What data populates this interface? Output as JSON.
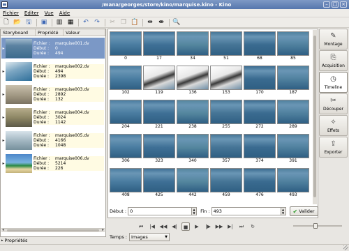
{
  "window": {
    "title": "/mana/georges/store/kino/marquise.kino - Kino",
    "app_icon": "film-icon",
    "controls": [
      "minimize",
      "maximize",
      "close"
    ]
  },
  "menu": [
    "Fichier",
    "Editer",
    "Vue",
    "Aide"
  ],
  "toolbar": {
    "icons": [
      "new-icon",
      "open-icon",
      "save-icon",
      "export-icon",
      "cut-scene-icon",
      "split-scene-icon",
      "undo-icon",
      "redo-icon",
      "cut-icon",
      "copy-icon",
      "paste-icon",
      "trim-start-icon",
      "trim-end-icon",
      "zoom-icon"
    ]
  },
  "storyboard": {
    "headers": [
      "Storyboard",
      "Propriété",
      "Valeur"
    ],
    "field_labels": [
      "Fichier :",
      "Début :",
      "Durée :"
    ],
    "clips": [
      {
        "file": "marquise001.dv",
        "start": "0",
        "duration": "494",
        "selected": true,
        "palette": "sea"
      },
      {
        "file": "marquise002.dv",
        "start": "494",
        "duration": "2398",
        "selected": false,
        "palette": "pool"
      },
      {
        "file": "marquise003.dv",
        "start": "2892",
        "duration": "132",
        "selected": false,
        "palette": "sand"
      },
      {
        "file": "marquise004.dv",
        "start": "3024",
        "duration": "1142",
        "selected": false,
        "palette": "rock"
      },
      {
        "file": "marquise005.dv",
        "start": "4166",
        "duration": "1048",
        "selected": false,
        "palette": "boat"
      },
      {
        "file": "marquise006.dv",
        "start": "5214",
        "duration": "226",
        "selected": false,
        "palette": "beach"
      }
    ],
    "properties_label": "Propriétés"
  },
  "frames": [
    {
      "label": "0",
      "kind": "sea"
    },
    {
      "label": "17",
      "kind": "sea"
    },
    {
      "label": "34",
      "kind": "sea"
    },
    {
      "label": "51",
      "kind": "sea"
    },
    {
      "label": "68",
      "kind": "sea"
    },
    {
      "label": "85",
      "kind": "sea"
    },
    {
      "label": "102",
      "kind": "sea"
    },
    {
      "label": "119",
      "kind": "deck"
    },
    {
      "label": "136",
      "kind": "deck"
    },
    {
      "label": "153",
      "kind": "deck"
    },
    {
      "label": "170",
      "kind": "sea"
    },
    {
      "label": "187",
      "kind": "sea"
    },
    {
      "label": "204",
      "kind": "sea"
    },
    {
      "label": "221",
      "kind": "sea"
    },
    {
      "label": "238",
      "kind": "sea"
    },
    {
      "label": "255",
      "kind": "sea"
    },
    {
      "label": "272",
      "kind": "sea"
    },
    {
      "label": "289",
      "kind": "sea"
    },
    {
      "label": "306",
      "kind": "sea"
    },
    {
      "label": "323",
      "kind": "sea"
    },
    {
      "label": "340",
      "kind": "sea"
    },
    {
      "label": "357",
      "kind": "sea"
    },
    {
      "label": "374",
      "kind": "sea"
    },
    {
      "label": "391",
      "kind": "sea"
    },
    {
      "label": "408",
      "kind": "sea"
    },
    {
      "label": "425",
      "kind": "sea"
    },
    {
      "label": "442",
      "kind": "sea"
    },
    {
      "label": "459",
      "kind": "sea"
    },
    {
      "label": "476",
      "kind": "sea"
    },
    {
      "label": "493",
      "kind": "sea"
    }
  ],
  "range": {
    "start_label": "Début :",
    "start_value": "0",
    "end_label": "Fin :",
    "end_value": "493",
    "validate_label": "Valider"
  },
  "modes": [
    {
      "label": "Montage",
      "icon": "edit-icon",
      "active": false
    },
    {
      "label": "Acquisition",
      "icon": "capture-icon",
      "active": false
    },
    {
      "label": "Timeline",
      "icon": "clock-icon",
      "active": true
    },
    {
      "label": "Découper",
      "icon": "trim-icon",
      "active": false
    },
    {
      "label": "Effets",
      "icon": "effects-icon",
      "active": false
    },
    {
      "label": "Exporter",
      "icon": "export-icon",
      "active": false
    }
  ],
  "transport": [
    "first-scene-icon",
    "previous-scene-icon",
    "rewind-icon",
    "step-back-icon",
    "stop-icon",
    "play-icon",
    "step-forward-icon",
    "fast-forward-icon",
    "next-scene-icon",
    "last-scene-icon",
    "loop-icon"
  ],
  "volume_level": 0.45,
  "time": {
    "label": "Temps :",
    "unit_value": "Images"
  },
  "colors": {
    "selection": "#7b98c6",
    "titlebar": "#5576ad",
    "sea": "#3d6b8e"
  }
}
